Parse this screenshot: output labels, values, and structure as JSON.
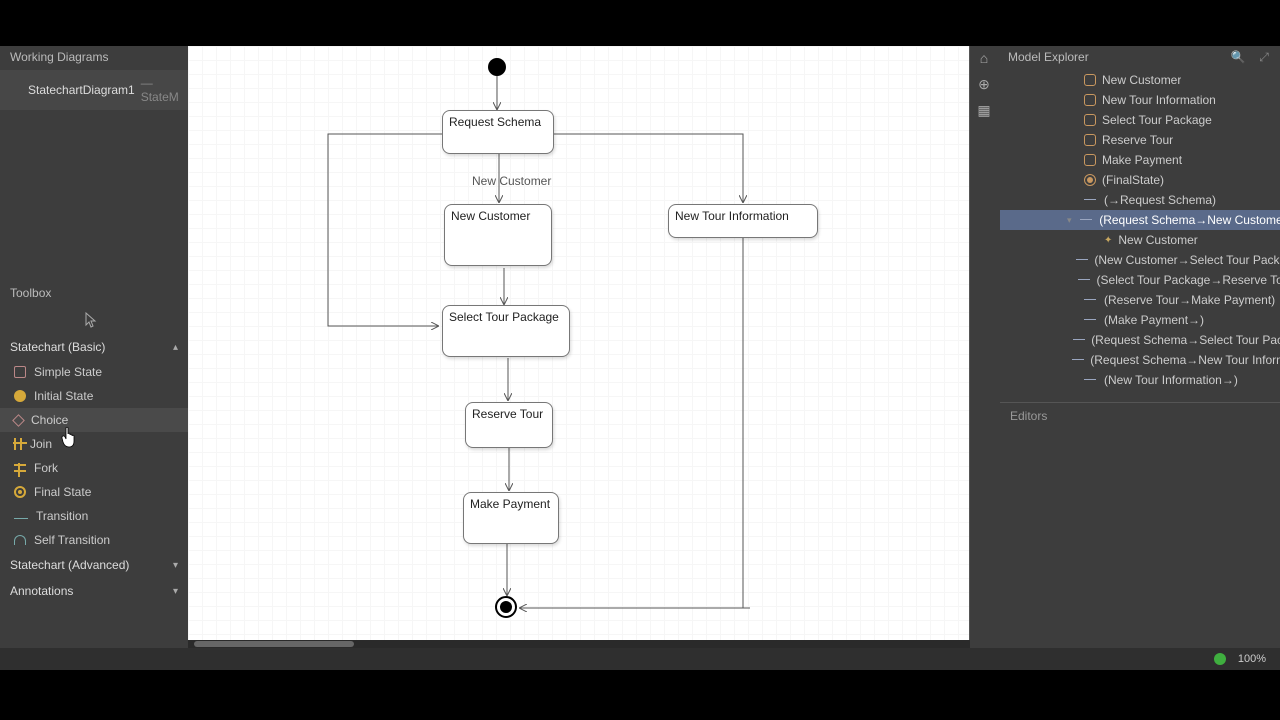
{
  "left": {
    "workingTitle": "Working Diagrams",
    "diagramTab": {
      "name": "StatechartDiagram1",
      "suffix": "— StateM"
    },
    "toolboxTitle": "Toolbox",
    "groups": {
      "basic": {
        "label": "Statechart (Basic)"
      },
      "advanced": {
        "label": "Statechart (Advanced)"
      },
      "annotations": {
        "label": "Annotations"
      }
    },
    "items": {
      "simpleState": "Simple State",
      "initialState": "Initial State",
      "choice": "Choice",
      "join": "Join",
      "fork": "Fork",
      "finalState": "Final State",
      "transition": "Transition",
      "selfTransition": "Self Transition"
    }
  },
  "diagram": {
    "states": {
      "requestSchema": "Request Schema",
      "newCustomer": "New Customer",
      "newTourInfo": "New Tour Information",
      "selectTourPackage": "Select Tour Package",
      "reserveTour": "Reserve Tour",
      "makePayment": "Make Payment"
    },
    "labels": {
      "newCustomer": "New Customer"
    }
  },
  "right": {
    "title": "Model Explorer",
    "items": [
      {
        "text": "New Customer",
        "kind": "state",
        "indent": 76
      },
      {
        "text": "New Tour Information",
        "kind": "state",
        "indent": 76
      },
      {
        "text": "Select Tour Package",
        "kind": "state",
        "indent": 76
      },
      {
        "text": "Reserve Tour",
        "kind": "state",
        "indent": 76
      },
      {
        "text": "Make Payment",
        "kind": "state",
        "indent": 76
      },
      {
        "text": "(FinalState)",
        "kind": "final",
        "indent": 76
      },
      {
        "text": "(→Request Schema)",
        "kind": "trans",
        "indent": 76
      },
      {
        "text": "(Request Schema→New Customer)",
        "kind": "trans",
        "indent": 76,
        "arrow": "▾",
        "selected": true
      },
      {
        "text": "New Customer",
        "kind": "label",
        "indent": 96
      },
      {
        "text": "(New Customer→Select Tour Package)",
        "kind": "trans",
        "indent": 76
      },
      {
        "text": "(Select Tour Package→Reserve Tour)",
        "kind": "trans",
        "indent": 76
      },
      {
        "text": "(Reserve Tour→Make Payment)",
        "kind": "trans",
        "indent": 76
      },
      {
        "text": "(Make Payment→)",
        "kind": "trans",
        "indent": 76
      },
      {
        "text": "(Request Schema→Select Tour Package)",
        "kind": "trans",
        "indent": 76
      },
      {
        "text": "(Request Schema→New Tour Information)",
        "kind": "trans",
        "indent": 76
      },
      {
        "text": "(New Tour Information→)",
        "kind": "trans",
        "indent": 76
      }
    ],
    "editorsTitle": "Editors"
  },
  "status": {
    "zoom": "100%"
  }
}
